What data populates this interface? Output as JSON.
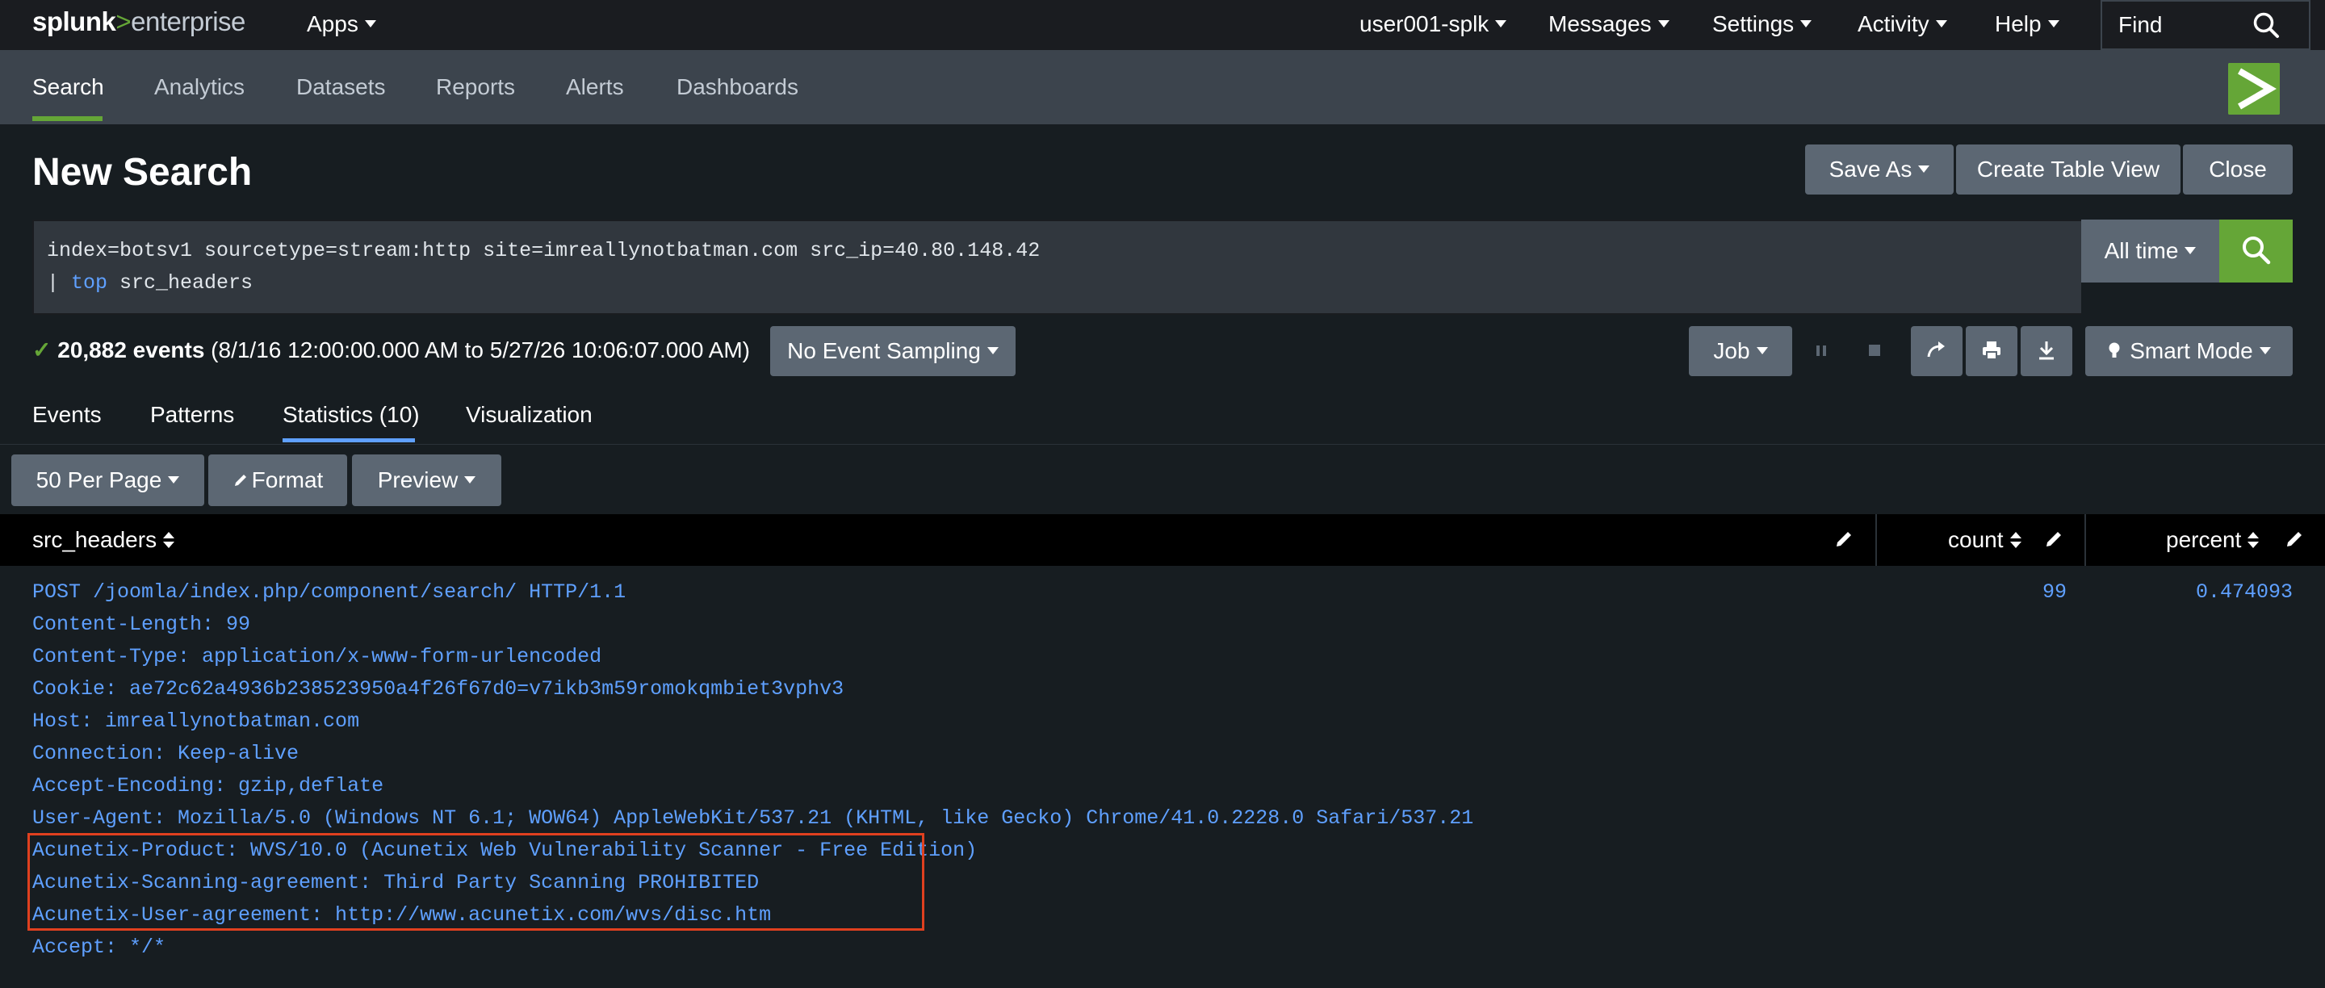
{
  "topbar": {
    "logo": {
      "part1": "splunk",
      "part2": ">",
      "part3": "enterprise"
    },
    "apps": "Apps",
    "user": "user001-splk",
    "messages": "Messages",
    "settings": "Settings",
    "activity": "Activity",
    "help": "Help",
    "find_placeholder": "Find"
  },
  "appbar": {
    "tabs": [
      "Search",
      "Analytics",
      "Datasets",
      "Reports",
      "Alerts",
      "Dashboards"
    ],
    "active_tab": "Search"
  },
  "page": {
    "title": "New Search",
    "save_as": "Save As",
    "create_table_view": "Create Table View",
    "close": "Close"
  },
  "search": {
    "line1": "index=botsv1 sourcetype=stream:http site=imreallynotbatman.com src_ip=40.80.148.42",
    "line2_pipe": "| ",
    "line2_command": "top",
    "line2_rest": " src_headers",
    "time_range": "All time"
  },
  "status": {
    "check": "✓",
    "event_count": "20,882 events",
    "range": "(8/1/16 12:00:00.000 AM to 5/27/26 10:06:07.000 AM)",
    "sampling": "No Event Sampling",
    "job": "Job",
    "mode": "Smart Mode"
  },
  "result_tabs": {
    "tabs": [
      "Events",
      "Patterns",
      "Statistics (10)",
      "Visualization"
    ],
    "active_tab": "Statistics (10)"
  },
  "toolbar": {
    "per_page": "50 Per Page",
    "format": "Format",
    "preview": "Preview"
  },
  "table": {
    "columns": [
      "src_headers",
      "count",
      "percent"
    ],
    "rows": [
      {
        "src_headers": [
          "POST /joomla/index.php/component/search/ HTTP/1.1",
          "Content-Length: 99",
          "Content-Type: application/x-www-form-urlencoded",
          "Cookie: ae72c62a4936b238523950a4f26f67d0=v7ikb3m59romokqmbiet3vphv3",
          "Host: imreallynotbatman.com",
          "Connection: Keep-alive",
          "Accept-Encoding: gzip,deflate",
          "User-Agent: Mozilla/5.0 (Windows NT 6.1; WOW64) AppleWebKit/537.21 (KHTML, like Gecko) Chrome/41.0.2228.0 Safari/537.21",
          "Acunetix-Product: WVS/10.0 (Acunetix Web Vulnerability Scanner - Free Edition)",
          "Acunetix-Scanning-agreement: Third Party Scanning PROHIBITED",
          "Acunetix-User-agreement: http://www.acunetix.com/wvs/disc.htm",
          "Accept: */*"
        ],
        "count": "99",
        "percent": "0.474093"
      }
    ]
  },
  "colors": {
    "accent_green": "#65a637",
    "link_blue": "#5fa0ff",
    "highlight_red": "#e0401f"
  }
}
